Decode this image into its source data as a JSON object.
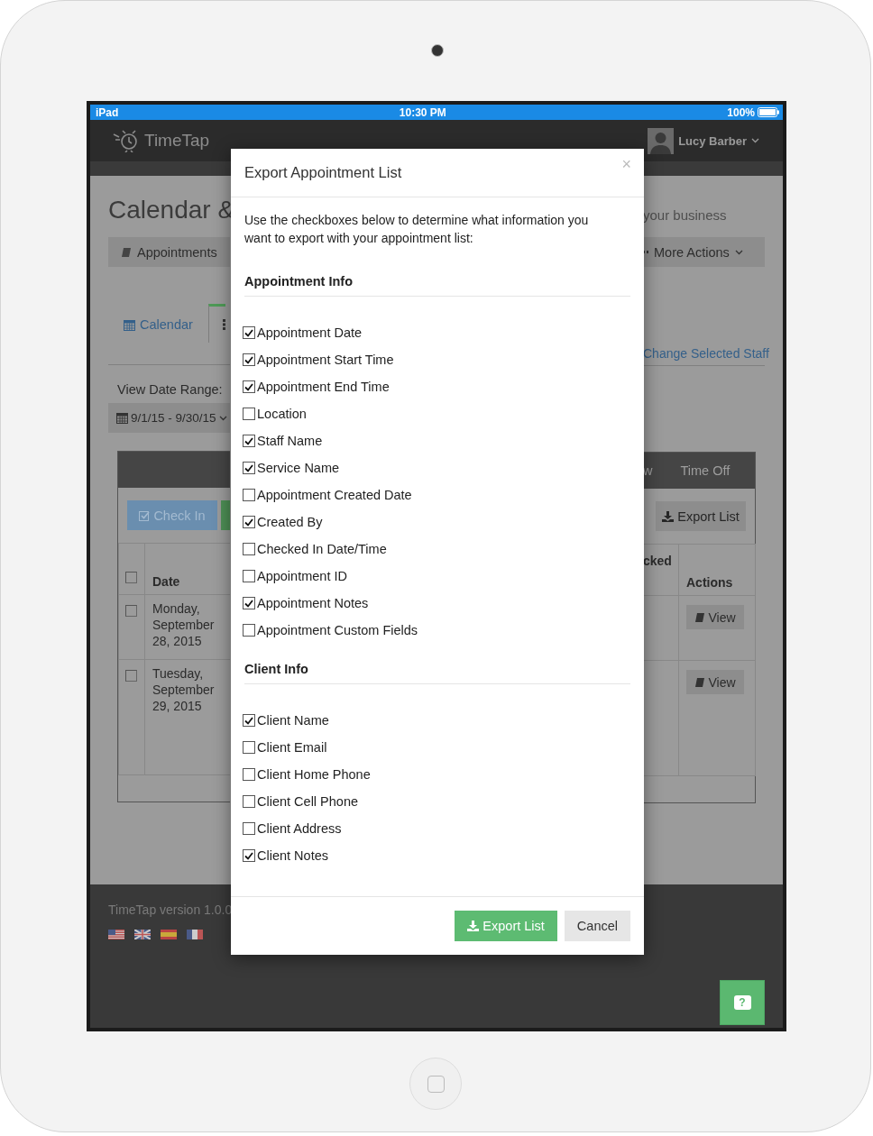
{
  "status_bar": {
    "device": "iPad",
    "time": "10:30 PM",
    "battery": "100%"
  },
  "app_header": {
    "logo": "TimeTap",
    "user": "Lucy Barber"
  },
  "page": {
    "title": "Calendar &",
    "subtitle": "your business",
    "appointments_menu": "Appointments",
    "more_actions_menu": "More Actions",
    "tabs": [
      {
        "label": "Calendar",
        "selected": false
      },
      {
        "selected": true
      }
    ],
    "change_staff_link": "Change Selected Staff",
    "date_range": {
      "label": "View Date Range:",
      "value": "9/1/15 - 9/30/15"
    },
    "panel": {
      "view_tabs": [
        "w",
        "Time Off"
      ],
      "check_in_button": "Check In",
      "export_button": "Export List",
      "table": {
        "columns": [
          "Date",
          "cked",
          "Actions"
        ],
        "header_checked": false,
        "rows": [
          {
            "date": "Monday, September 28, 2015",
            "checked": false,
            "action": "View"
          },
          {
            "date": "Tuesday, September 29, 2015",
            "checked": false,
            "action": "View"
          }
        ]
      }
    }
  },
  "footer": {
    "version": "TimeTap version 1.0.0",
    "help_button": "?"
  },
  "modal": {
    "title": "Export Appointment List",
    "close": "×",
    "intro": "Use the checkboxes below to determine what information you want to export with your appointment list:",
    "sections": [
      {
        "heading": "Appointment Info",
        "options": [
          {
            "label": "Appointment Date",
            "checked": true
          },
          {
            "label": "Appointment Start Time",
            "checked": true
          },
          {
            "label": "Appointment End Time",
            "checked": true
          },
          {
            "label": "Location",
            "checked": false
          },
          {
            "label": "Staff Name",
            "checked": true
          },
          {
            "label": "Service Name",
            "checked": true
          },
          {
            "label": "Appointment Created Date",
            "checked": false
          },
          {
            "label": "Created By",
            "checked": true
          },
          {
            "label": "Checked In Date/Time",
            "checked": false
          },
          {
            "label": "Appointment ID",
            "checked": false
          },
          {
            "label": "Appointment Notes",
            "checked": true
          },
          {
            "label": "Appointment Custom Fields",
            "checked": false
          }
        ]
      },
      {
        "heading": "Client Info",
        "options": [
          {
            "label": "Client Name",
            "checked": true
          },
          {
            "label": "Client Email",
            "checked": false
          },
          {
            "label": "Client Home Phone",
            "checked": false
          },
          {
            "label": "Client Cell Phone",
            "checked": false
          },
          {
            "label": "Client Address",
            "checked": false
          },
          {
            "label": "Client Notes",
            "checked": true
          }
        ]
      }
    ],
    "buttons": [
      {
        "label": "Export List",
        "kind": "primary"
      },
      {
        "label": "Cancel",
        "kind": "default"
      }
    ]
  }
}
